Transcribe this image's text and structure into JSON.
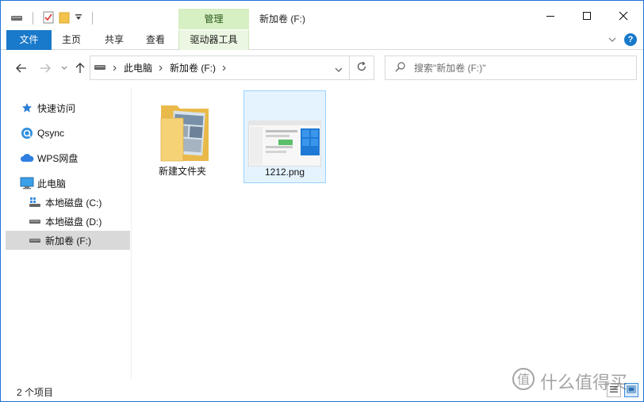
{
  "title": {
    "contextual_tab": "管理",
    "window_title": "新加卷 (F:)"
  },
  "ribbon": {
    "tabs": [
      "文件",
      "主页",
      "共享",
      "查看",
      "驱动器工具"
    ]
  },
  "address": {
    "crumbs": [
      "此电脑",
      "新加卷 (F:)"
    ],
    "search_placeholder": "搜索\"新加卷 (F:)\""
  },
  "sidebar": {
    "items": [
      {
        "label": "快速访问",
        "icon": "star-icon"
      },
      {
        "label": "Qsync",
        "icon": "qsync-icon"
      },
      {
        "label": "WPS网盘",
        "icon": "cloud-icon"
      },
      {
        "label": "此电脑",
        "icon": "computer-icon"
      },
      {
        "label": "本地磁盘 (C:)",
        "icon": "windows-drive-icon"
      },
      {
        "label": "本地磁盘 (D:)",
        "icon": "drive-icon"
      },
      {
        "label": "新加卷 (F:)",
        "icon": "drive-icon",
        "selected": true
      }
    ]
  },
  "files": [
    {
      "name": "新建文件夹",
      "type": "folder",
      "icon": "folder-icon"
    },
    {
      "name": "1212.png",
      "type": "image",
      "icon": "image-thumbnail",
      "selected": true
    }
  ],
  "status": {
    "item_count": "2 个项目"
  },
  "watermark": {
    "text": "什么值得买",
    "logo_glyph": "值"
  },
  "colors": {
    "accent": "#1979ca",
    "contextual": "#d6efc3",
    "selection": "#e5f3ff"
  }
}
